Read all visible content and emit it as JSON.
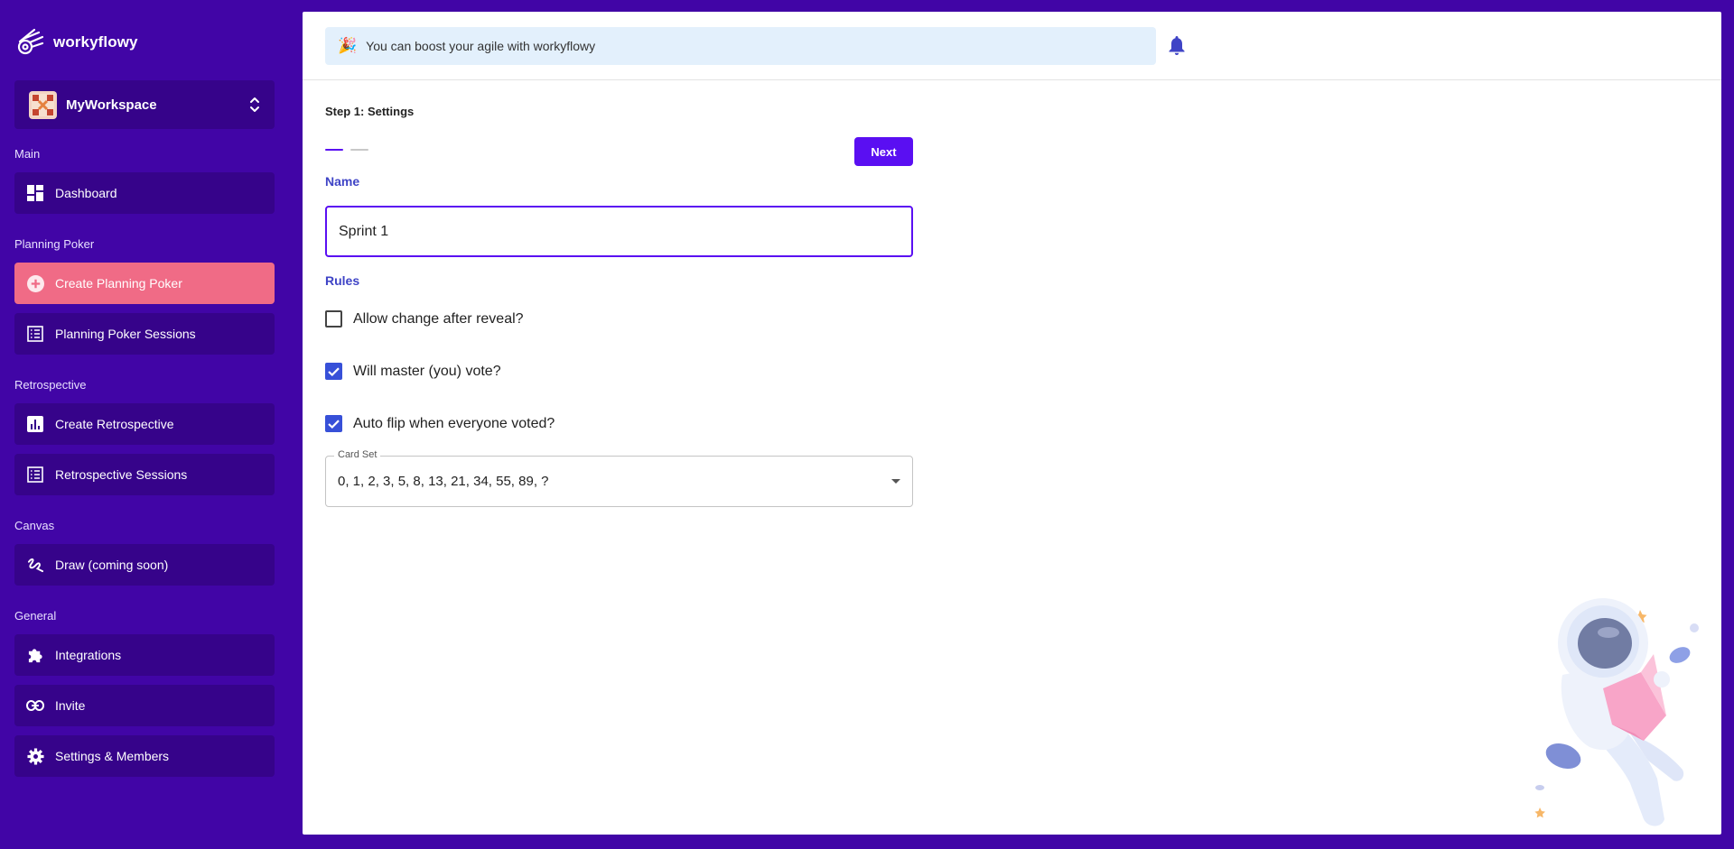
{
  "app": {
    "name": "workyflowy"
  },
  "workspace": {
    "name": "MyWorkspace"
  },
  "sidebar": {
    "sections": {
      "main": "Main",
      "planning": "Planning Poker",
      "retro": "Retrospective",
      "canvas": "Canvas",
      "general": "General"
    },
    "items": {
      "dashboard": {
        "label": "Dashboard",
        "icon": "dashboard-icon"
      },
      "create_poker": {
        "label": "Create Planning Poker",
        "icon": "add-circle-icon"
      },
      "poker_sessions": {
        "label": "Planning Poker Sessions",
        "icon": "list-icon"
      },
      "create_retro": {
        "label": "Create Retrospective",
        "icon": "chart-icon"
      },
      "retro_sessions": {
        "label": "Retrospective Sessions",
        "icon": "list-icon"
      },
      "draw": {
        "label": "Draw (coming soon)",
        "icon": "draw-icon"
      },
      "integrations": {
        "label": "Integrations",
        "icon": "puzzle-icon"
      },
      "invite": {
        "label": "Invite",
        "icon": "link-icon"
      },
      "settings": {
        "label": "Settings & Members",
        "icon": "gear-icon"
      }
    }
  },
  "banner": {
    "text": "You can boost your agile with workyflowy",
    "icon": "party-icon"
  },
  "form": {
    "step_title": "Step 1: Settings",
    "next_label": "Next",
    "name_label": "Name",
    "name_value": "Sprint 1",
    "rules_label": "Rules",
    "rules": {
      "allow_change": {
        "label": "Allow change after reveal?",
        "checked": false
      },
      "master_vote": {
        "label": "Will master (you) vote?",
        "checked": true
      },
      "auto_flip": {
        "label": "Auto flip when everyone voted?",
        "checked": true
      }
    },
    "card_set_label": "Card Set",
    "card_set_value": "0, 1, 2, 3, 5, 8, 13, 21, 34, 55, 89, ?"
  },
  "colors": {
    "background": "#4105a6",
    "sidebar_item": "#36038a",
    "active_item": "#f06b86",
    "primary": "#5a0ff2",
    "label_blue": "#3f44c6",
    "checkbox": "#3750d8"
  }
}
